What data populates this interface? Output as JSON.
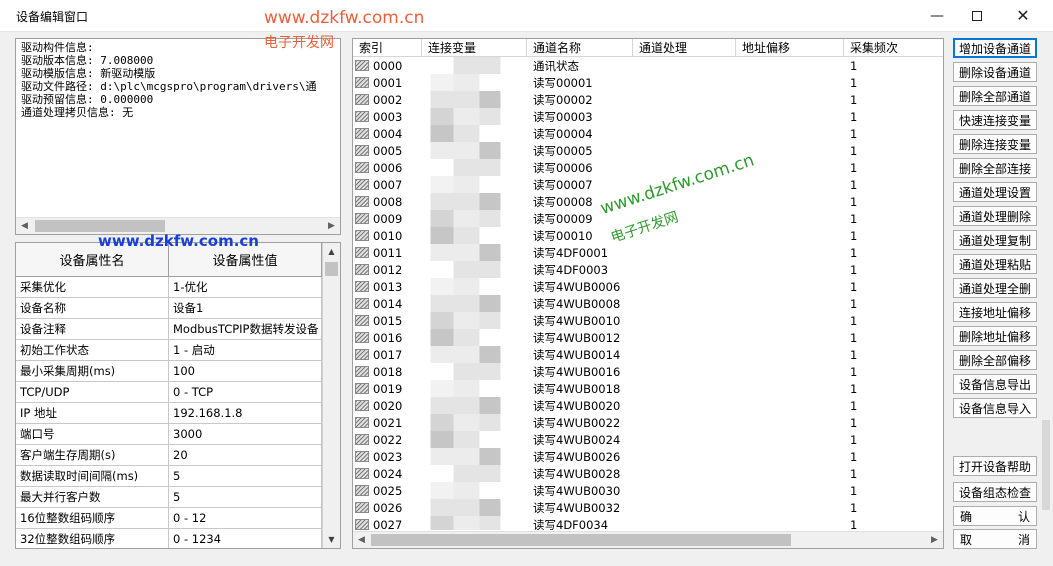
{
  "window": {
    "title": "设备编辑窗口",
    "min_icon": "minimize-icon",
    "max_icon": "maximize-icon",
    "close_icon": "close-icon",
    "close_glyph": "✕",
    "min_glyph": "—"
  },
  "watermarks": {
    "top_url": "www.dzkfw.com.cn",
    "top_name": "电子开发网",
    "left_url": "www.dzkfw.com.cn",
    "mid_url": "www.dzkfw.com.cn",
    "mid_name": "电子开发网"
  },
  "info": {
    "lines": [
      "驱动构件信息:",
      "驱动版本信息: 7.008000",
      "驱动模版信息: 新驱动模版",
      "驱动文件路径: d:\\plc\\mcgspro\\program\\drivers\\通",
      "驱动预留信息: 0.000000",
      "通道处理拷贝信息: 无"
    ]
  },
  "props": {
    "header_name": "设备属性名",
    "header_value": "设备属性值",
    "rows": [
      {
        "name": "采集优化",
        "value": "1-优化"
      },
      {
        "name": "设备名称",
        "value": "设备1"
      },
      {
        "name": "设备注释",
        "value": "ModbusTCPIP数据转发设备"
      },
      {
        "name": "初始工作状态",
        "value": "1 - 启动"
      },
      {
        "name": "最小采集周期(ms)",
        "value": "100"
      },
      {
        "name": "TCP/UDP",
        "value": "0 - TCP"
      },
      {
        "name": "IP 地址",
        "value": "192.168.1.8"
      },
      {
        "name": "端口号",
        "value": "3000"
      },
      {
        "name": "客户端生存周期(s)",
        "value": "20"
      },
      {
        "name": "数据读取时间间隔(ms)",
        "value": "5"
      },
      {
        "name": "最大并行客户数",
        "value": "5"
      },
      {
        "name": "16位整数组码顺序",
        "value": "0 - 12"
      },
      {
        "name": "32位整数组码顺序",
        "value": "0 - 1234"
      }
    ]
  },
  "channels": {
    "headers": [
      "索引",
      "连接变量",
      "通道名称",
      "通道处理",
      "地址偏移",
      "采集频次"
    ],
    "rows": [
      {
        "index": "0000",
        "name": "通讯状态",
        "freq": "1"
      },
      {
        "index": "0001",
        "name": "读写00001",
        "freq": "1"
      },
      {
        "index": "0002",
        "name": "读写00002",
        "freq": "1"
      },
      {
        "index": "0003",
        "name": "读写00003",
        "freq": "1"
      },
      {
        "index": "0004",
        "name": "读写00004",
        "freq": "1"
      },
      {
        "index": "0005",
        "name": "读写00005",
        "freq": "1"
      },
      {
        "index": "0006",
        "name": "读写00006",
        "freq": "1"
      },
      {
        "index": "0007",
        "name": "读写00007",
        "freq": "1"
      },
      {
        "index": "0008",
        "name": "读写00008",
        "freq": "1"
      },
      {
        "index": "0009",
        "name": "读写00009",
        "freq": "1"
      },
      {
        "index": "0010",
        "name": "读写00010",
        "freq": "1"
      },
      {
        "index": "0011",
        "name": "读写4DF0001",
        "freq": "1"
      },
      {
        "index": "0012",
        "name": "读写4DF0003",
        "freq": "1"
      },
      {
        "index": "0013",
        "name": "读写4WUB0006",
        "freq": "1"
      },
      {
        "index": "0014",
        "name": "读写4WUB0008",
        "freq": "1"
      },
      {
        "index": "0015",
        "name": "读写4WUB0010",
        "freq": "1"
      },
      {
        "index": "0016",
        "name": "读写4WUB0012",
        "freq": "1"
      },
      {
        "index": "0017",
        "name": "读写4WUB0014",
        "freq": "1"
      },
      {
        "index": "0018",
        "name": "读写4WUB0016",
        "freq": "1"
      },
      {
        "index": "0019",
        "name": "读写4WUB0018",
        "freq": "1"
      },
      {
        "index": "0020",
        "name": "读写4WUB0020",
        "freq": "1"
      },
      {
        "index": "0021",
        "name": "读写4WUB0022",
        "freq": "1"
      },
      {
        "index": "0022",
        "name": "读写4WUB0024",
        "freq": "1"
      },
      {
        "index": "0023",
        "name": "读写4WUB0026",
        "freq": "1"
      },
      {
        "index": "0024",
        "name": "读写4WUB0028",
        "freq": "1"
      },
      {
        "index": "0025",
        "name": "读写4WUB0030",
        "freq": "1"
      },
      {
        "index": "0026",
        "name": "读写4WUB0032",
        "freq": "1"
      },
      {
        "index": "0027",
        "name": "读写4DF0034",
        "freq": "1"
      }
    ]
  },
  "buttons": {
    "add_channel": "增加设备通道",
    "del_channel": "删除设备通道",
    "del_all_channels": "删除全部通道",
    "quick_link": "快速连接变量",
    "del_link": "删除连接变量",
    "del_all_links": "删除全部连接",
    "proc_set": "通道处理设置",
    "proc_del": "通道处理删除",
    "proc_copy": "通道处理复制",
    "proc_paste": "通道处理粘贴",
    "proc_del_all": "通道处理全删",
    "link_offset": "连接地址偏移",
    "del_offset": "删除地址偏移",
    "del_all_offset": "删除全部偏移",
    "export_info": "设备信息导出",
    "import_info": "设备信息导入",
    "open_help": "打开设备帮助",
    "check_config": "设备组态检查",
    "confirm_a": "确",
    "confirm_b": "认",
    "cancel_a": "取",
    "cancel_b": "消"
  },
  "icons": {
    "row": "channel-row-icon",
    "scroll_up": "scroll-up-arrow-icon",
    "scroll_down": "scroll-down-arrow-icon",
    "scroll_left": "scroll-left-arrow-icon",
    "scroll_right": "scroll-right-arrow-icon"
  },
  "colors": {
    "watermark_orange": "#e8603c",
    "watermark_blue": "#1a3fd6",
    "watermark_green": "#2e9a2e",
    "primary_button_border": "#0078d7"
  }
}
